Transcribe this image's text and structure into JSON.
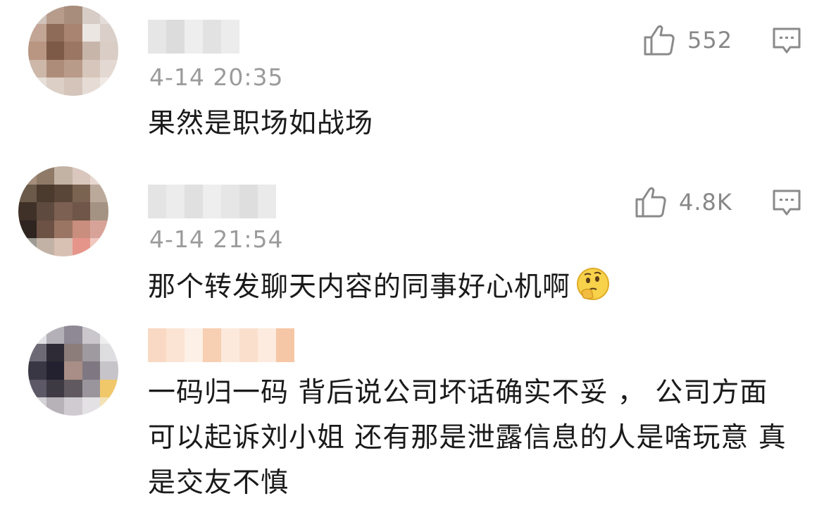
{
  "comments": [
    {
      "timestamp": "4-14 20:35",
      "text": "果然是职场如战场",
      "like_count": "552",
      "emoji": ""
    },
    {
      "timestamp": "4-14 21:54",
      "text": "那个转发聊天内容的同事好心机啊",
      "like_count": "4.8K",
      "emoji": "thinking-face-emoji"
    },
    {
      "timestamp": "",
      "text": "一码归一码  背后说公司坏话确实不妥 ，  公司方面可以起诉刘小姐  还有那是泄露信息的人是啥玩意  真是交友不慎",
      "like_count": "",
      "emoji": ""
    }
  ],
  "icons": {
    "like": "thumbs-up-icon",
    "reply": "comment-bubble-icon"
  },
  "colors": {
    "text": "#1a1a1a",
    "meta": "#9b9b9b",
    "icon": "#8a8a8a"
  }
}
